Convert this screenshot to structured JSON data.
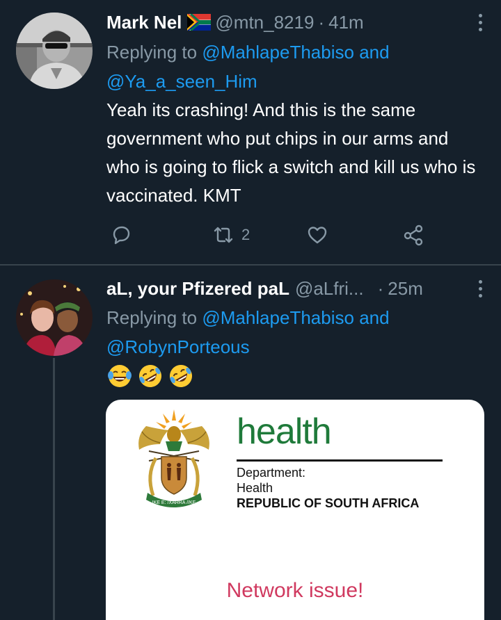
{
  "tweets": [
    {
      "display_name": "Mark Nel",
      "handle": "@mtn_8219",
      "timestamp": "41m",
      "reply_prefix": "Replying to",
      "reply_mention_1": "@MahlapeThabiso",
      "reply_and": "and",
      "reply_mention_2": "@Ya_a_seen_Him",
      "text": "Yeah its crashing! And this is the same government who put chips in our arms and who is going to flick a switch and kill us who is vaccinated. KMT",
      "retweet_count": "2",
      "flag_icon": "south-africa-flag-icon"
    },
    {
      "display_name": "aL, your Pfizered paL",
      "handle": "@aLfri...",
      "timestamp": "25m",
      "reply_prefix": "Replying to",
      "reply_mention_1": "@MahlapeThabiso",
      "reply_and": "and",
      "reply_mention_2": "@RobynPorteous",
      "emojis": [
        "face-with-tears-of-joy",
        "rolling-on-the-floor-laughing",
        "rolling-on-the-floor-laughing"
      ],
      "media": {
        "brand_word": "health",
        "dept_label": "Department:",
        "dept_name": "Health",
        "country": "REPUBLIC OF SOUTH AFRICA",
        "coat_motto": "!KE E: /XARRA //KE",
        "message": "Network issue!"
      }
    }
  ],
  "colors": {
    "background": "#15202b",
    "text_primary": "#ffffff",
    "text_secondary": "#8899a6",
    "link": "#1d9bf0",
    "divider": "#38444d",
    "health_green": "#1f7a3a",
    "network_red": "#d0395f"
  }
}
